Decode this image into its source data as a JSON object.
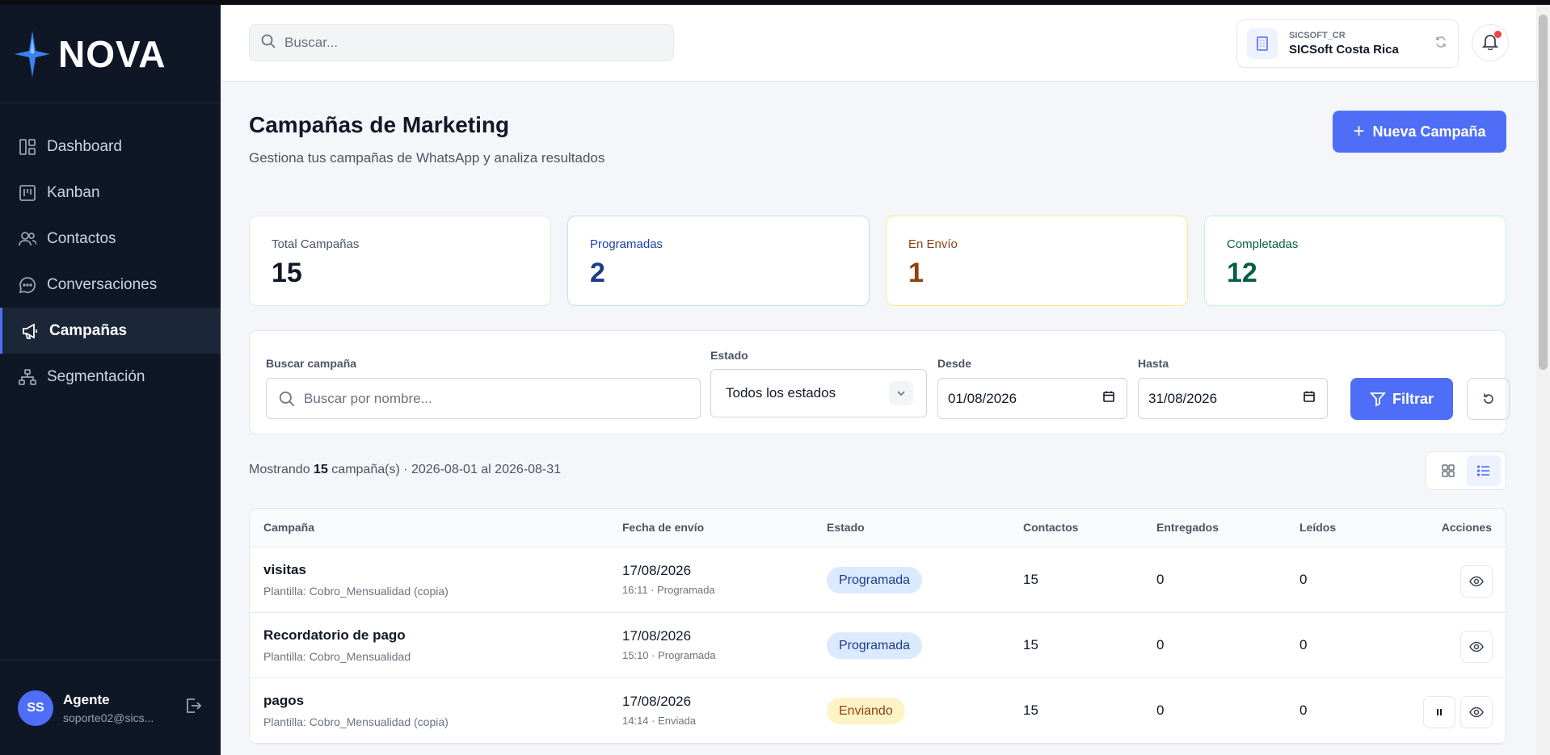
{
  "app": {
    "logo": "NOVA"
  },
  "sidebar": {
    "items": [
      {
        "label": "Dashboard",
        "icon": "dashboard-icon"
      },
      {
        "label": "Kanban",
        "icon": "kanban-icon"
      },
      {
        "label": "Contactos",
        "icon": "contacts-icon"
      },
      {
        "label": "Conversaciones",
        "icon": "chat-icon"
      },
      {
        "label": "Campañas",
        "icon": "megaphone-icon",
        "active": true
      },
      {
        "label": "Segmentación",
        "icon": "segmentation-icon"
      }
    ],
    "user": {
      "initials": "SS",
      "name": "Agente",
      "email": "soporte02@sics..."
    }
  },
  "header": {
    "search_placeholder": "Buscar...",
    "company_code": "SICSOFT_CR",
    "company_name": "SICSoft Costa Rica"
  },
  "page": {
    "title": "Campañas de Marketing",
    "subtitle": "Gestiona tus campañas de WhatsApp y analiza resultados",
    "new_button": "Nueva Campaña"
  },
  "stats": [
    {
      "label": "Total Campañas",
      "value": "15",
      "color": "#111827",
      "label_color": "#4b5563",
      "border": "#e5e7eb"
    },
    {
      "label": "Programadas",
      "value": "2",
      "color": "#1e3a8a",
      "label_color": "#1e40af",
      "border": "#bfdbfe"
    },
    {
      "label": "En Envío",
      "value": "1",
      "color": "#92400e",
      "label_color": "#92400e",
      "border": "#fde68a"
    },
    {
      "label": "Completadas",
      "value": "12",
      "color": "#065f46",
      "label_color": "#065f46",
      "border": "#bbf7d0"
    }
  ],
  "filters": {
    "search_label": "Buscar campaña",
    "search_placeholder": "Buscar por nombre...",
    "status_label": "Estado",
    "status_value": "Todos los estados",
    "from_label": "Desde",
    "from_value": "01/08/2026",
    "to_label": "Hasta",
    "to_value": "31/08/2026",
    "filter_button": "Filtrar"
  },
  "summary": {
    "prefix": "Mostrando",
    "count": "15",
    "suffix": "campaña(s) · 2026-08-01 al 2026-08-31"
  },
  "table": {
    "headers": [
      "Campaña",
      "Fecha de envío",
      "Estado",
      "Contactos",
      "Entregados",
      "Leídos",
      "Acciones"
    ],
    "rows": [
      {
        "name": "visitas",
        "template": "Plantilla: Cobro_Mensualidad (copia)",
        "date": "17/08/2026",
        "time": "16:11 · Programada",
        "status": "Programada",
        "contacts": "15",
        "delivered": "0",
        "read": "0"
      },
      {
        "name": "Recordatorio de pago",
        "template": "Plantilla: Cobro_Mensualidad",
        "date": "17/08/2026",
        "time": "15:10 · Programada",
        "status": "Programada",
        "contacts": "15",
        "delivered": "0",
        "read": "0"
      },
      {
        "name": "pagos",
        "template": "Plantilla: Cobro_Mensualidad (copia)",
        "date": "17/08/2026",
        "time": "14:14 · Enviada",
        "status": "Enviando",
        "contacts": "15",
        "delivered": "0",
        "read": "0"
      }
    ]
  }
}
